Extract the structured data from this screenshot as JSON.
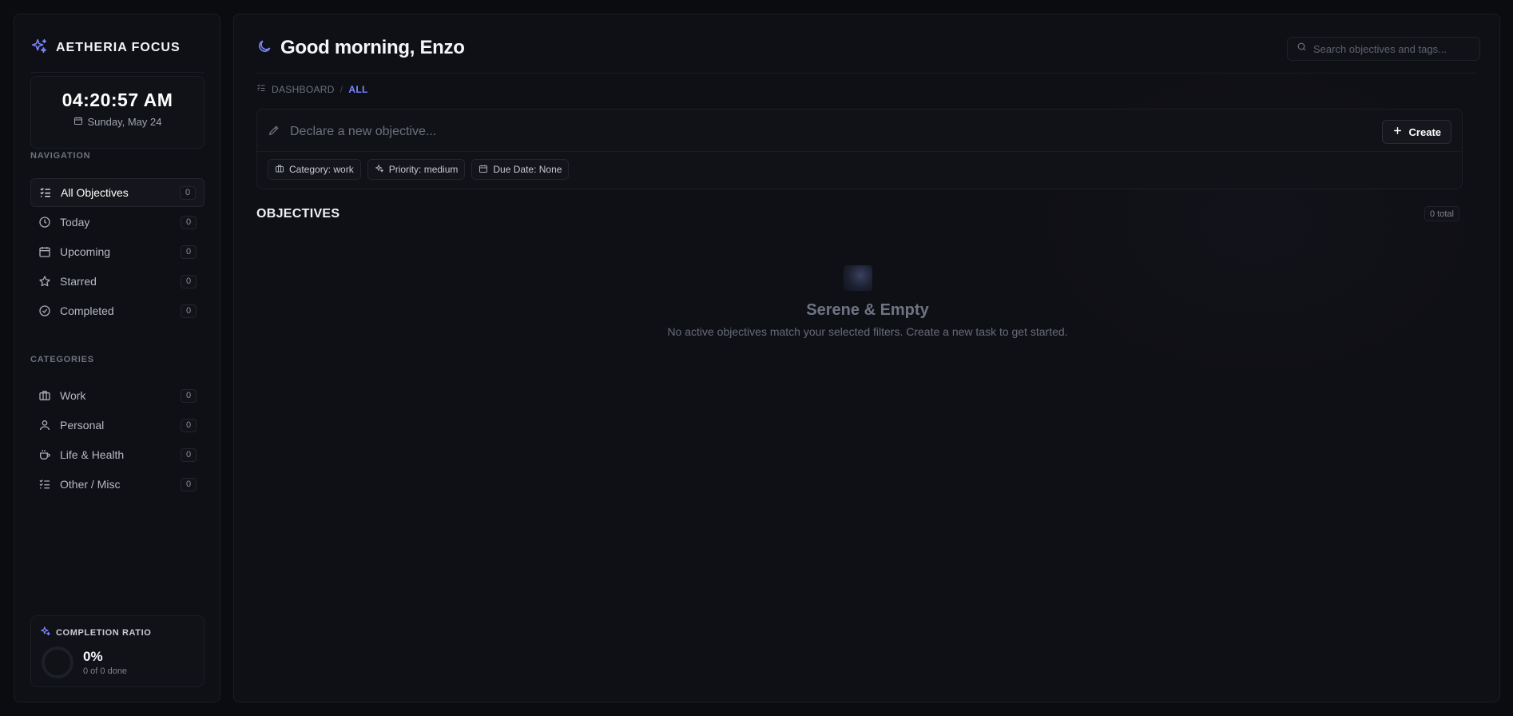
{
  "app": {
    "name": "AETHERIA FOCUS"
  },
  "clock": {
    "time": "04:20:57 AM",
    "date": "Sunday, May 24"
  },
  "navigation": {
    "label": "NAVIGATION",
    "items": [
      {
        "label": "All Objectives",
        "count": "0",
        "icon": "list-icon",
        "active": true
      },
      {
        "label": "Today",
        "count": "0",
        "icon": "clock-icon"
      },
      {
        "label": "Upcoming",
        "count": "0",
        "icon": "calendar-icon"
      },
      {
        "label": "Starred",
        "count": "0",
        "icon": "star-icon"
      },
      {
        "label": "Completed",
        "count": "0",
        "icon": "check-circle-icon"
      }
    ]
  },
  "categories": {
    "label": "CATEGORIES",
    "items": [
      {
        "label": "Work",
        "count": "0",
        "icon": "briefcase-icon"
      },
      {
        "label": "Personal",
        "count": "0",
        "icon": "user-icon"
      },
      {
        "label": "Life & Health",
        "count": "0",
        "icon": "coffee-icon"
      },
      {
        "label": "Other / Misc",
        "count": "0",
        "icon": "list-icon"
      }
    ]
  },
  "completion": {
    "title": "COMPLETION RATIO",
    "percent": "0%",
    "detail": "0 of 0 done",
    "ratio": 0
  },
  "header": {
    "greeting": "Good morning, Enzo",
    "search_placeholder": "Search objectives and tags..."
  },
  "breadcrumb": {
    "root": "DASHBOARD",
    "separator": "/",
    "current": "ALL"
  },
  "composer": {
    "placeholder": "Declare a new objective...",
    "create_label": "Create",
    "chips": {
      "category": "Category: work",
      "priority": "Priority: medium",
      "due_date": "Due Date: None"
    }
  },
  "objectives": {
    "title": "OBJECTIVES",
    "total": "0 total",
    "empty_title": "Serene & Empty",
    "empty_message": "No active objectives match your selected filters. Create a new task to get started."
  },
  "colors": {
    "accent": "#7c86ff",
    "background": "#0b0c10",
    "panel": "#0f1015"
  }
}
